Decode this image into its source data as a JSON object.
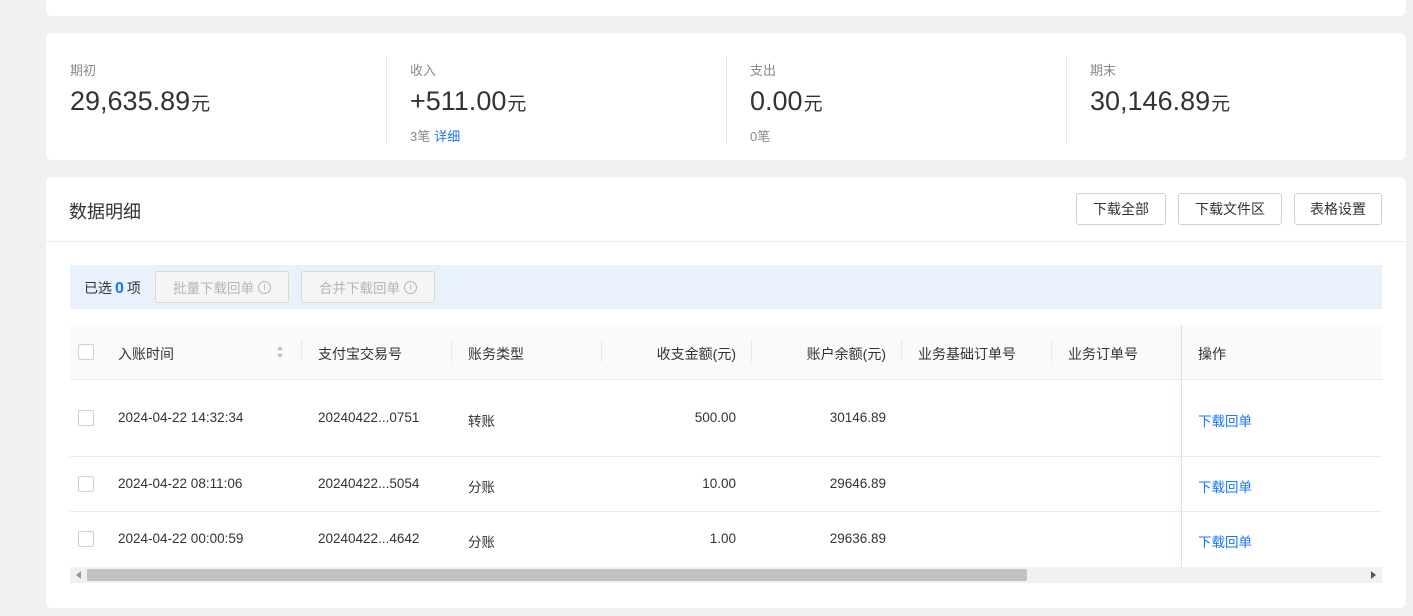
{
  "summary": {
    "opening": {
      "label": "期初",
      "value": "29,635.89",
      "unit": "元"
    },
    "income": {
      "label": "收入",
      "value": "+511.00",
      "unit": "元",
      "count": "3笔",
      "detail_link": "详细"
    },
    "expense": {
      "label": "支出",
      "value": "0.00",
      "unit": "元",
      "count": "0笔"
    },
    "closing": {
      "label": "期末",
      "value": "30,146.89",
      "unit": "元"
    }
  },
  "detail": {
    "title": "数据明细",
    "buttons": {
      "download_all": "下载全部",
      "download_files": "下载文件区",
      "table_settings": "表格设置"
    },
    "selection": {
      "prefix": "已选",
      "count": "0",
      "suffix": "项",
      "batch_download": "批量下载回单",
      "merge_download": "合并下载回单"
    },
    "columns": [
      "入账时间",
      "支付宝交易号",
      "账务类型",
      "收支金额(元)",
      "账户余额(元)",
      "业务基础订单号",
      "业务订单号",
      "操作"
    ],
    "rows": [
      {
        "time": "2024-04-22 14:32:34",
        "trade_no": "20240422...0751",
        "type": "转账",
        "amount": "500.00",
        "balance": "30146.89",
        "base_order": "",
        "order": "",
        "action": "下载回单"
      },
      {
        "time": "2024-04-22 08:11:06",
        "trade_no": "20240422...5054",
        "type": "分账",
        "amount": "10.00",
        "balance": "29646.89",
        "base_order": "",
        "order": "",
        "action": "下载回单"
      },
      {
        "time": "2024-04-22 00:00:59",
        "trade_no": "20240422...4642",
        "type": "分账",
        "amount": "1.00",
        "balance": "29636.89",
        "base_order": "",
        "order": "",
        "action": "下载回单"
      }
    ]
  },
  "icons": {
    "info": "info-circle-icon",
    "sort": "sort-icon"
  }
}
